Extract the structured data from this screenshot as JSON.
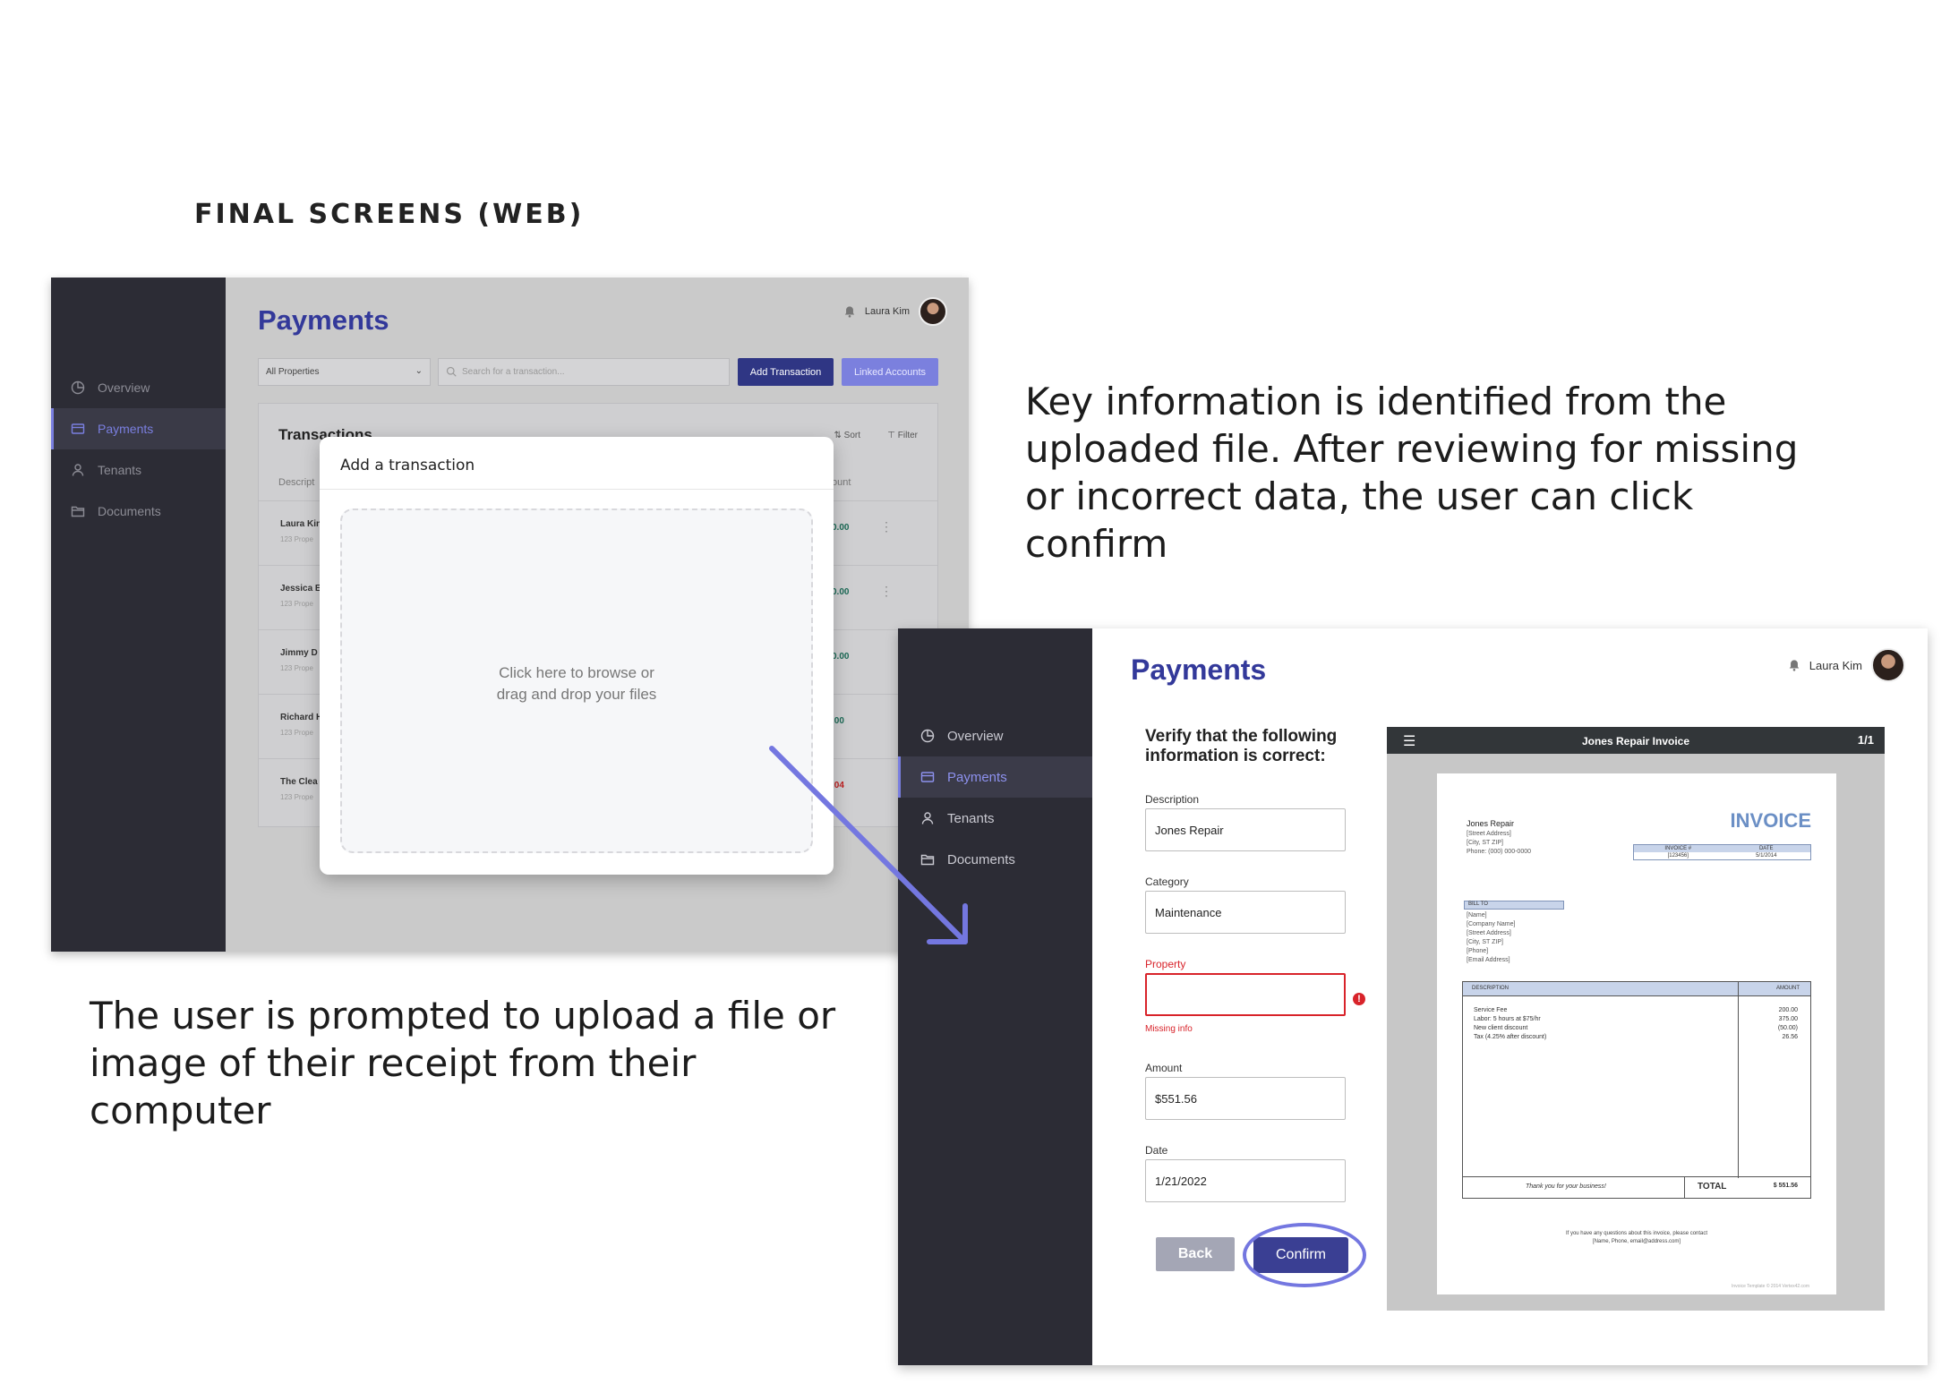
{
  "heading": "FINAL SCREENS (WEB)",
  "captions": {
    "left": "The user is prompted to upload a file or image of their receipt from their computer",
    "right": "Key information is identified from the uploaded file. After reviewing for missing or incorrect data, the user can click confirm"
  },
  "nav": {
    "items": [
      {
        "label": "Overview",
        "icon": "pie-chart-icon"
      },
      {
        "label": "Payments",
        "icon": "credit-card-icon"
      },
      {
        "label": "Tenants",
        "icon": "user-icon"
      },
      {
        "label": "Documents",
        "icon": "folder-icon"
      }
    ],
    "active": "Payments"
  },
  "screen1": {
    "title": "Payments",
    "user": "Laura Kim",
    "property_select": "All Properties",
    "search_placeholder": "Search for a transaction...",
    "add_button": "Add Transaction",
    "linked_button": "Linked Accounts",
    "card_title": "Transactions",
    "sort": "Sort",
    "filter": "Filter",
    "col_desc": "Descript",
    "col_amt": "ount",
    "rows": [
      {
        "name": "Laura Kin",
        "sub": "123 Prope",
        "amount": "0.00"
      },
      {
        "name": "Jessica E",
        "sub": "123 Prope",
        "amount": "0.00"
      },
      {
        "name": "Jimmy D",
        "sub": "123 Prope",
        "amount": "0.00"
      },
      {
        "name": "Richard H",
        "sub": "123 Prope",
        "amount": ".00"
      },
      {
        "name": "The Clea",
        "sub": "123 Prope",
        "amount": ".04"
      }
    ],
    "modal": {
      "title": "Add a transaction",
      "drop_line1": "Click here to browse or",
      "drop_line2": "drag and drop your files"
    }
  },
  "screen2": {
    "title": "Payments",
    "user": "Laura Kim",
    "verify": "Verify that the following information is correct:",
    "fields": {
      "description": {
        "label": "Description",
        "value": "Jones Repair"
      },
      "category": {
        "label": "Category",
        "value": "Maintenance"
      },
      "property": {
        "label": "Property",
        "value": "",
        "error": "Missing info"
      },
      "amount": {
        "label": "Amount",
        "value": "$551.56"
      },
      "date": {
        "label": "Date",
        "value": "1/21/2022"
      }
    },
    "back_button": "Back",
    "confirm_button": "Confirm",
    "viewer": {
      "title": "Jones Repair Invoice",
      "page": "1/1"
    },
    "invoice": {
      "company": "Jones Repair",
      "address": [
        "[Street Address]",
        "[City, ST ZIP]",
        "Phone: (000) 000-0000"
      ],
      "heading": "INVOICE",
      "invoice_no_label": "INVOICE #",
      "date_label": "DATE",
      "invoice_no": "[123456]",
      "date": "5/1/2014",
      "bill_to": "BILL TO",
      "bill_lines": [
        "[Name]",
        "[Company Name]",
        "[Street Address]",
        "[City, ST ZIP]",
        "[Phone]",
        "[Email Address]"
      ],
      "desc_header": "DESCRIPTION",
      "amount_header": "AMOUNT",
      "items": [
        {
          "desc": "Service Fee",
          "amount": "200.00"
        },
        {
          "desc": "Labor: 5 hours at $75/hr",
          "amount": "375.00"
        },
        {
          "desc": "New client discount",
          "amount": "(50.00)"
        },
        {
          "desc": "Tax (4.25% after discount)",
          "amount": "26.56"
        }
      ],
      "thanks": "Thank you for your business!",
      "total_label": "TOTAL",
      "total": "$ 551.56",
      "note1": "If you have any questions about this invoice, please contact",
      "note2": "[Name, Phone, email@address.com]",
      "footer": "Invoice Template © 2014 Vertex42.com"
    }
  }
}
